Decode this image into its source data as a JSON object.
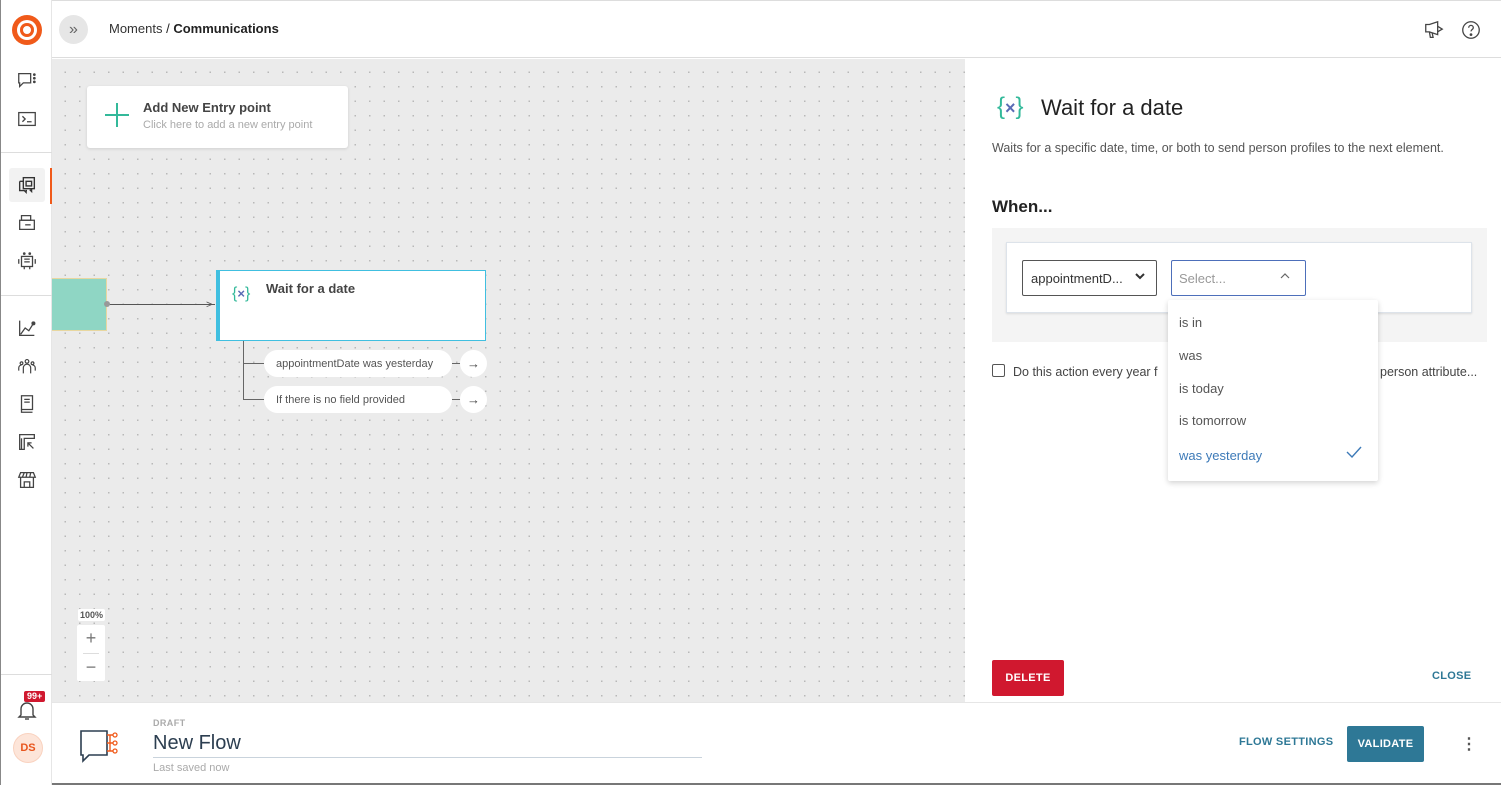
{
  "header": {
    "breadcrumb_parent": "Moments",
    "breadcrumb_separator": "/",
    "breadcrumb_current": "Communications",
    "icons": [
      "announcements-icon",
      "help-icon"
    ]
  },
  "left_nav": {
    "items": [
      {
        "name": "conversations",
        "icon": "chat-icon",
        "active": false
      },
      {
        "name": "console",
        "icon": "terminal-icon",
        "active": false
      },
      {
        "name": "moments",
        "icon": "flows-icon",
        "active": true
      },
      {
        "name": "templates",
        "icon": "templates-icon",
        "active": false
      },
      {
        "name": "bots",
        "icon": "robot-icon",
        "active": false
      },
      {
        "name": "analyze",
        "icon": "analytics-icon",
        "active": false
      },
      {
        "name": "people",
        "icon": "people-icon",
        "active": false
      },
      {
        "name": "knowledge",
        "icon": "book-icon",
        "active": false
      },
      {
        "name": "exports",
        "icon": "exports-icon",
        "active": false
      },
      {
        "name": "marketplace",
        "icon": "store-icon",
        "active": false
      }
    ],
    "notification_badge": "99+",
    "avatar_initials": "DS"
  },
  "canvas": {
    "entry_card": {
      "title": "Add New Entry point",
      "subtitle": "Click here to add a new entry point"
    },
    "wait_node": {
      "title": "Wait for a date",
      "icon_brace_left": "{",
      "icon_x": "×",
      "icon_brace_right": "}"
    },
    "branches": [
      {
        "label": "appointmentDate was yesterday",
        "arrow": "→"
      },
      {
        "label": "If there is no field provided",
        "arrow": "→"
      }
    ],
    "zoom": {
      "level": "100%",
      "plus": "+",
      "minus": "−"
    }
  },
  "panel": {
    "title": "Wait for a date",
    "description": "Waits for a specific date, time, or both to send person profiles to the next element.",
    "when_label": "When...",
    "attribute_select": {
      "value": "appointmentD...",
      "chevron": "❯"
    },
    "operator_select": {
      "placeholder": "Select...",
      "open": true
    },
    "operator_options": [
      {
        "label": "is in",
        "selected": false
      },
      {
        "label": "was",
        "selected": false
      },
      {
        "label": "is today",
        "selected": false
      },
      {
        "label": "is tomorrow",
        "selected": false
      },
      {
        "label": "was yesterday",
        "selected": true
      }
    ],
    "repeat_checkbox": {
      "checked": false,
      "label_visible_left": "Do this action every year f",
      "label_visible_right": "person attribute..."
    },
    "delete_label": "DELETE",
    "close_label": "CLOSE"
  },
  "footer": {
    "status": "DRAFT",
    "flow_name": "New Flow",
    "last_saved": "Last saved now",
    "flow_settings_label": "FLOW SETTINGS",
    "validate_label": "VALIDATE",
    "more_label": "⋮"
  },
  "colors": {
    "brand_orange": "#f05a1a",
    "accent_teal": "#33b99a",
    "primary_blue": "#2e7896",
    "danger_red": "#d0182f",
    "node_border": "#40bfe0",
    "selected_option": "#3d7ab8"
  }
}
